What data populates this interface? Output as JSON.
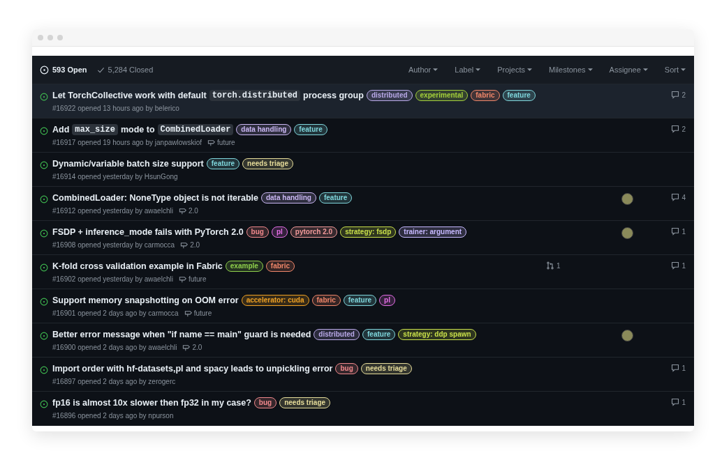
{
  "header": {
    "open": "593 Open",
    "closed": "5,284 Closed",
    "filters": [
      "Author",
      "Label",
      "Projects",
      "Milestones",
      "Assignee",
      "Sort"
    ]
  },
  "issues": [
    {
      "selected": true,
      "title": [
        {
          "kind": "text",
          "text": "Let TorchCollective work with default"
        },
        {
          "kind": "code",
          "text": "torch.distributed"
        },
        {
          "kind": "text",
          "text": "process group"
        }
      ],
      "labels": [
        {
          "name": "distributed",
          "color": "#b9a9e8"
        },
        {
          "name": "experimental",
          "color": "#a4d13b"
        },
        {
          "name": "fabric",
          "color": "#f0876a"
        },
        {
          "name": "feature",
          "color": "#7fd6dc"
        }
      ],
      "meta": "#16922 opened 13 hours ago by belerico",
      "comments": "2"
    },
    {
      "selected": false,
      "title": [
        {
          "kind": "text",
          "text": "Add"
        },
        {
          "kind": "code",
          "text": "max_size"
        },
        {
          "kind": "text",
          "text": "mode to"
        },
        {
          "kind": "code",
          "text": "CombinedLoader"
        }
      ],
      "labels": [
        {
          "name": "data handling",
          "color": "#c9b6f2"
        },
        {
          "name": "feature",
          "color": "#7fd6dc"
        }
      ],
      "meta": "#16917 opened 19 hours ago by janpawlowskiof",
      "milestone": "future",
      "comments": "2"
    },
    {
      "selected": false,
      "title": [
        {
          "kind": "text",
          "text": "Dynamic/variable batch size support"
        }
      ],
      "labels": [
        {
          "name": "feature",
          "color": "#7fd6dc"
        },
        {
          "name": "needs triage",
          "color": "#e6dc9a"
        }
      ],
      "meta": "#16914 opened yesterday by HsunGong"
    },
    {
      "selected": false,
      "title": [
        {
          "kind": "text",
          "text": "CombinedLoader: NoneType object is not iterable"
        }
      ],
      "labels": [
        {
          "name": "data handling",
          "color": "#c9b6f2"
        },
        {
          "name": "feature",
          "color": "#7fd6dc"
        }
      ],
      "meta": "#16912 opened yesterday by awaelchli",
      "milestone": "2.0",
      "assignee": true,
      "comments": "4"
    },
    {
      "selected": false,
      "title": [
        {
          "kind": "text",
          "text": "FSDP + inference_mode fails with PyTorch 2.0"
        }
      ],
      "labels": [
        {
          "name": "bug",
          "color": "#f0888c"
        },
        {
          "name": "pl",
          "color": "#e46ee6"
        },
        {
          "name": "pytorch 2.0",
          "color": "#f29a9a"
        },
        {
          "name": "strategy: fsdp",
          "color": "#c9e04a"
        },
        {
          "name": "trainer: argument",
          "color": "#c6b8ff"
        }
      ],
      "meta": "#16908 opened yesterday by carmocca",
      "milestone": "2.0",
      "assignee": true,
      "comments": "1"
    },
    {
      "selected": false,
      "title": [
        {
          "kind": "text",
          "text": "K-fold cross validation example in Fabric"
        }
      ],
      "labels": [
        {
          "name": "example",
          "color": "#8fd04c"
        },
        {
          "name": "fabric",
          "color": "#f0876a"
        }
      ],
      "meta": "#16902 opened yesterday by awaelchli",
      "milestone": "future",
      "pulls": "1",
      "comments": "1"
    },
    {
      "selected": false,
      "title": [
        {
          "kind": "text",
          "text": "Support memory snapshotting on OOM error"
        }
      ],
      "labels": [
        {
          "name": "accelerator: cuda",
          "color": "#f0a224"
        },
        {
          "name": "fabric",
          "color": "#f0876a"
        },
        {
          "name": "feature",
          "color": "#7fd6dc"
        },
        {
          "name": "pl",
          "color": "#e46ee6"
        }
      ],
      "meta": "#16901 opened 2 days ago by carmocca",
      "milestone": "future"
    },
    {
      "selected": false,
      "title": [
        {
          "kind": "text",
          "text": "Better error message when \"if name == main\" guard is needed"
        }
      ],
      "labels": [
        {
          "name": "distributed",
          "color": "#b9a9e8"
        },
        {
          "name": "feature",
          "color": "#7fd6dc"
        },
        {
          "name": "strategy: ddp spawn",
          "color": "#c9e04a"
        }
      ],
      "meta": "#16900 opened 2 days ago by awaelchli",
      "milestone": "2.0",
      "assignee": true
    },
    {
      "selected": false,
      "title": [
        {
          "kind": "text",
          "text": "Import order with hf-datasets,pl and spacy leads to unpickling error"
        }
      ],
      "labels": [
        {
          "name": "bug",
          "color": "#f0888c"
        },
        {
          "name": "needs triage",
          "color": "#e6dc9a"
        }
      ],
      "meta": "#16897 opened 2 days ago by zerogerc",
      "comments": "1"
    },
    {
      "selected": false,
      "title": [
        {
          "kind": "text",
          "text": "fp16 is almost 10x slower then fp32 in my case?"
        }
      ],
      "labels": [
        {
          "name": "bug",
          "color": "#f0888c"
        },
        {
          "name": "needs triage",
          "color": "#e6dc9a"
        }
      ],
      "meta": "#16896 opened 2 days ago by npurson",
      "comments": "1"
    }
  ]
}
